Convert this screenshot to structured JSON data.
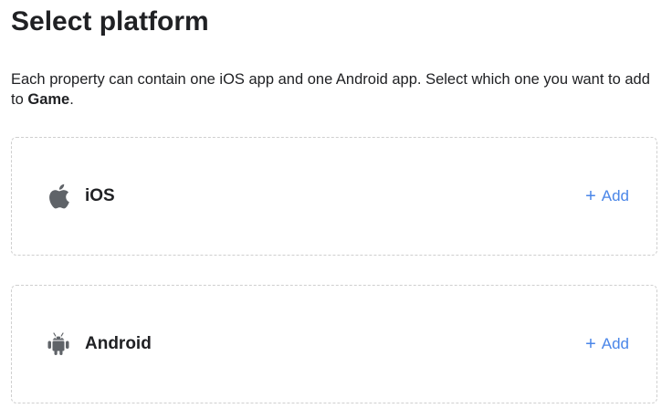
{
  "header": {
    "title": "Select platform"
  },
  "description": {
    "text_before": "Each property can contain one iOS app and one Android app. Select which one you want to add to ",
    "property_name": "Game",
    "text_after": "."
  },
  "platforms": [
    {
      "name": "iOS",
      "icon": "apple-icon",
      "action_icon": "+",
      "action_label": "Add"
    },
    {
      "name": "Android",
      "icon": "android-icon",
      "action_icon": "+",
      "action_label": "Add"
    }
  ],
  "colors": {
    "accent": "#4a86e8",
    "icon": "#5f6368",
    "border": "#cfcfcf"
  }
}
